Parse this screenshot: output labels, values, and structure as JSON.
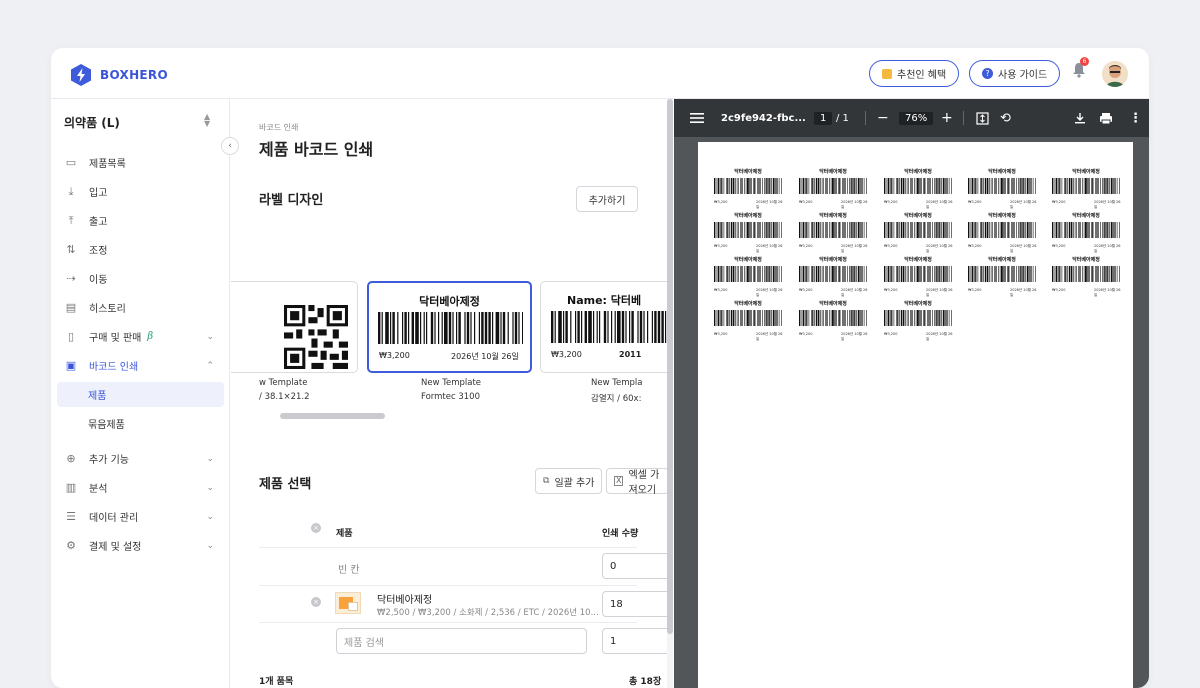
{
  "topbar": {
    "logo_text": "BOXHERO",
    "referral_label": "추천인 혜택",
    "guide_label": "사용 가이드",
    "notification_count": "6"
  },
  "sidebar": {
    "workspace": "의약품 (L)",
    "items": [
      {
        "label": "제품목록",
        "icon": "box-icon"
      },
      {
        "label": "입고",
        "icon": "download-icon"
      },
      {
        "label": "출고",
        "icon": "upload-icon"
      },
      {
        "label": "조정",
        "icon": "swap-icon"
      },
      {
        "label": "이동",
        "icon": "move-icon"
      },
      {
        "label": "히스토리",
        "icon": "history-icon"
      },
      {
        "label": "구매 및 판매",
        "icon": "document-icon",
        "badge": "β"
      },
      {
        "label": "바코드 인쇄",
        "icon": "barcode-icon"
      },
      {
        "label": "추가 기능",
        "icon": "plus-circle-icon"
      },
      {
        "label": "분석",
        "icon": "chart-icon"
      },
      {
        "label": "데이터 관리",
        "icon": "database-icon"
      },
      {
        "label": "결제 및 설정",
        "icon": "gear-icon"
      }
    ],
    "sub_items": [
      "제품",
      "묶음제품"
    ]
  },
  "main": {
    "breadcrumb": "바코드 인쇄",
    "title": "제품 바코드 인쇄",
    "label_design_title": "라벨 디자인",
    "add_label": "추가하기",
    "cards": [
      {
        "caption1": "w Template",
        "caption2": "/ 38.1×21.2"
      },
      {
        "name": "닥터베아제정",
        "price": "₩3,200",
        "date": "2026년 10월 26일",
        "caption1": "New Template",
        "caption2": "Formtec 3100"
      },
      {
        "name": "Name: 닥터베",
        "price": "₩3,200",
        "date": "2011",
        "caption1": "New Templa",
        "caption2": "감열지 / 60x:"
      }
    ],
    "product_select_title": "제품 선택",
    "bulk_add_label": "일괄 추가",
    "excel_import_label": "엑셀 가져오기",
    "col_product": "제품",
    "col_qty": "인쇄 수량",
    "rows": [
      {
        "name": "빈 칸",
        "qty": "0"
      },
      {
        "name": "닥터베아제정",
        "detail": "₩2,500 / ₩3,200 / 소화제 / 2,536 / ETC / 2026년 10...",
        "qty": "18"
      }
    ],
    "search_placeholder": "제품 검색",
    "search_qty": "1",
    "footer_count": "1개 품목",
    "footer_total": "총 18장"
  },
  "pdf": {
    "filename": "2c9fe942-fbc...",
    "page_current": "1",
    "page_total": "/ 1",
    "zoom": "76%",
    "label_name": "닥터베아제정",
    "label_price": "₩3,200",
    "label_date": "2026년 10월 26일",
    "label_count": 18
  }
}
